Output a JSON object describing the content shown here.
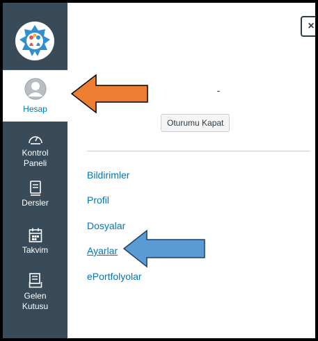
{
  "nav": {
    "items": [
      {
        "id": "account",
        "label": "Hesap",
        "icon": "user-avatar-icon",
        "active": true
      },
      {
        "id": "dashboard",
        "label": "Kontrol Paneli",
        "icon": "dashboard-gauge-icon"
      },
      {
        "id": "courses",
        "label": "Dersler",
        "icon": "book-icon"
      },
      {
        "id": "calendar",
        "label": "Takvim",
        "icon": "calendar-icon"
      },
      {
        "id": "inbox",
        "label": "Gelen Kutusu",
        "icon": "inbox-icon"
      }
    ]
  },
  "tray": {
    "close_label": "×",
    "user_name": "-",
    "logout_label": "Oturumu Kapat",
    "links": [
      {
        "label": "Bildirimler"
      },
      {
        "label": "Profil"
      },
      {
        "label": "Dosyalar"
      },
      {
        "label": "Ayarlar",
        "current": true
      },
      {
        "label": "ePortfolyolar"
      }
    ]
  },
  "colors": {
    "nav_bg": "#394b58",
    "link": "#0374b5",
    "arrow_orange": "#ed7d31",
    "arrow_blue": "#5b9bd5"
  }
}
